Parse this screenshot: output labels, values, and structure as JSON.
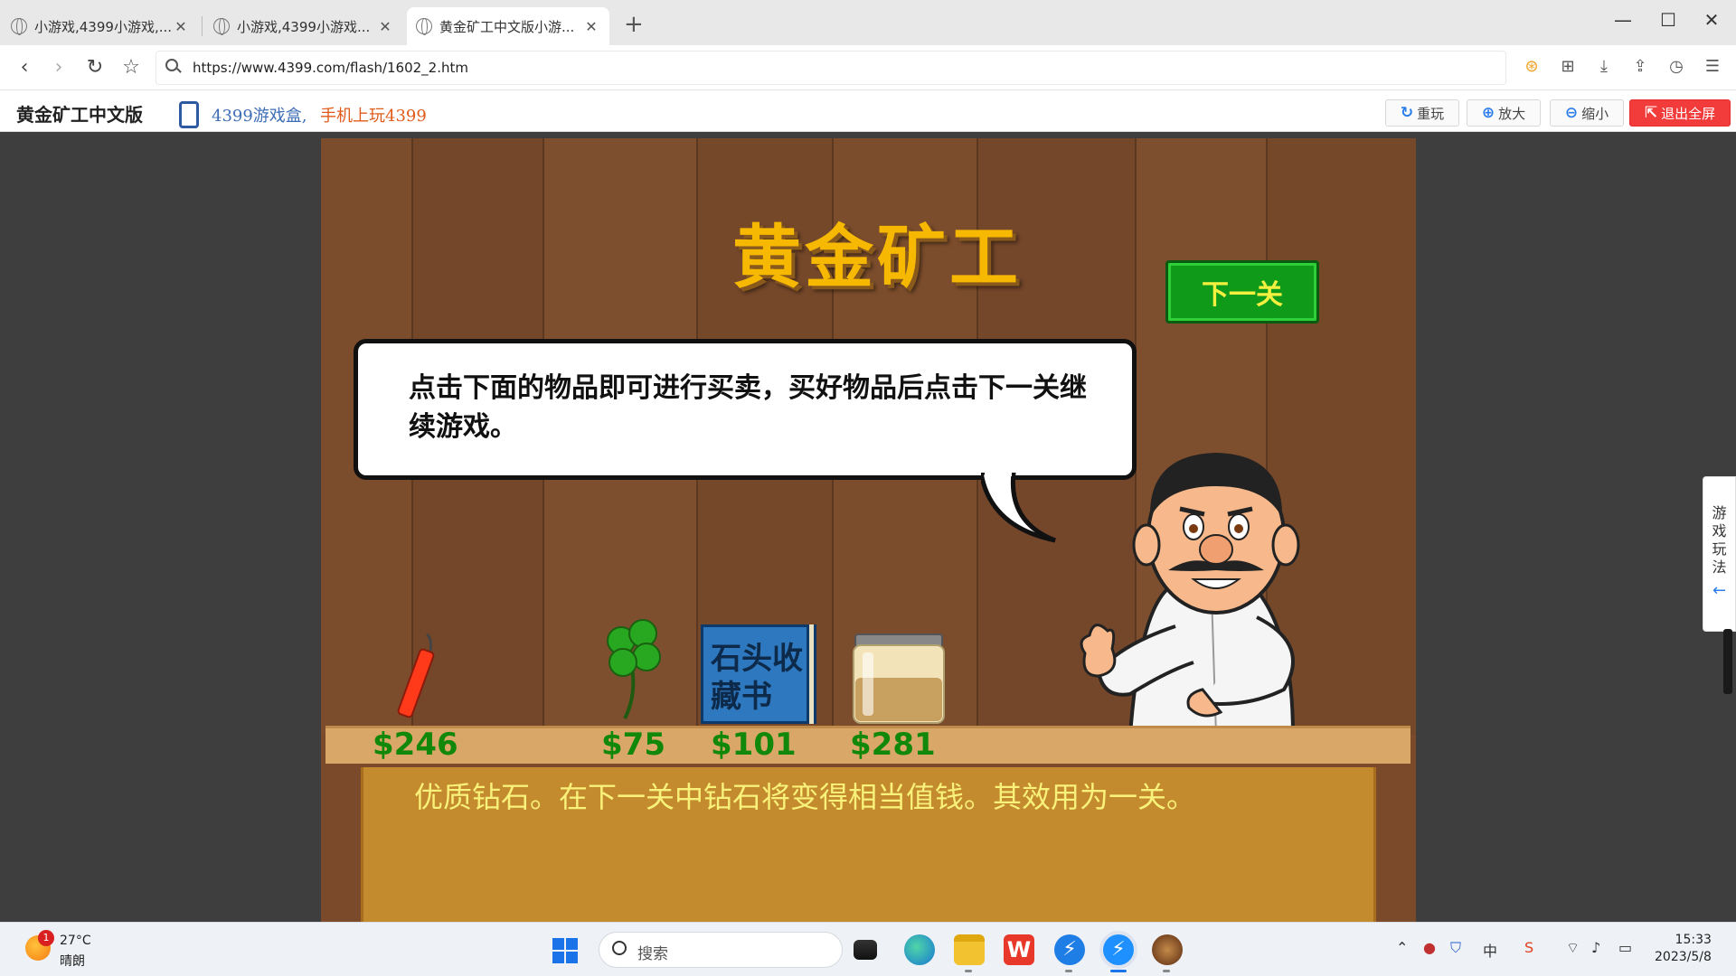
{
  "browser": {
    "tabs": [
      {
        "label": "小游戏,4399小游戏,...",
        "active": false
      },
      {
        "label": "小游戏,4399小游戏...",
        "active": false
      },
      {
        "label": "黄金矿工中文版小游...",
        "active": true
      }
    ],
    "url": "https://www.4399.com/flash/1602_2.htm"
  },
  "gamebar": {
    "title": "黄金矿工中文版",
    "promo_part1": "4399游戏盒,",
    "promo_part2": "手机上玩4399",
    "buttons": {
      "replay": "重玩",
      "zoom_in": "放大",
      "zoom_out": "缩小",
      "exit_fullscreen": "退出全屏"
    }
  },
  "game": {
    "title": "黄金矿工",
    "next_level": "下一关",
    "dialog": "点击下面的物品即可进行买卖，买好物品后点击下一关继续游戏。",
    "items": [
      {
        "name": "dynamite",
        "price": "$246"
      },
      {
        "name": "clover",
        "price": "$75"
      },
      {
        "name": "stone-book",
        "price": "$101",
        "book_text_line1": "石头收",
        "book_text_line2": "藏书"
      },
      {
        "name": "jar",
        "price": "$281"
      }
    ],
    "description": "优质钻石。在下一关中钻石将变得相当值钱。其效用为一关。"
  },
  "sidetab": {
    "chars": [
      "游",
      "戏",
      "玩",
      "法"
    ],
    "arrow": "←"
  },
  "taskbar": {
    "weather_badge": "1",
    "temperature": "27°C",
    "weather_desc": "晴朗",
    "search_placeholder": "搜索",
    "tray_ime": "中",
    "time": "15:33",
    "date": "2023/5/8"
  },
  "colors": {
    "title_gold": "#f6b800",
    "price_green": "#11880a",
    "next_btn": "#0f9a1a",
    "exit_btn": "#f23c3c"
  }
}
